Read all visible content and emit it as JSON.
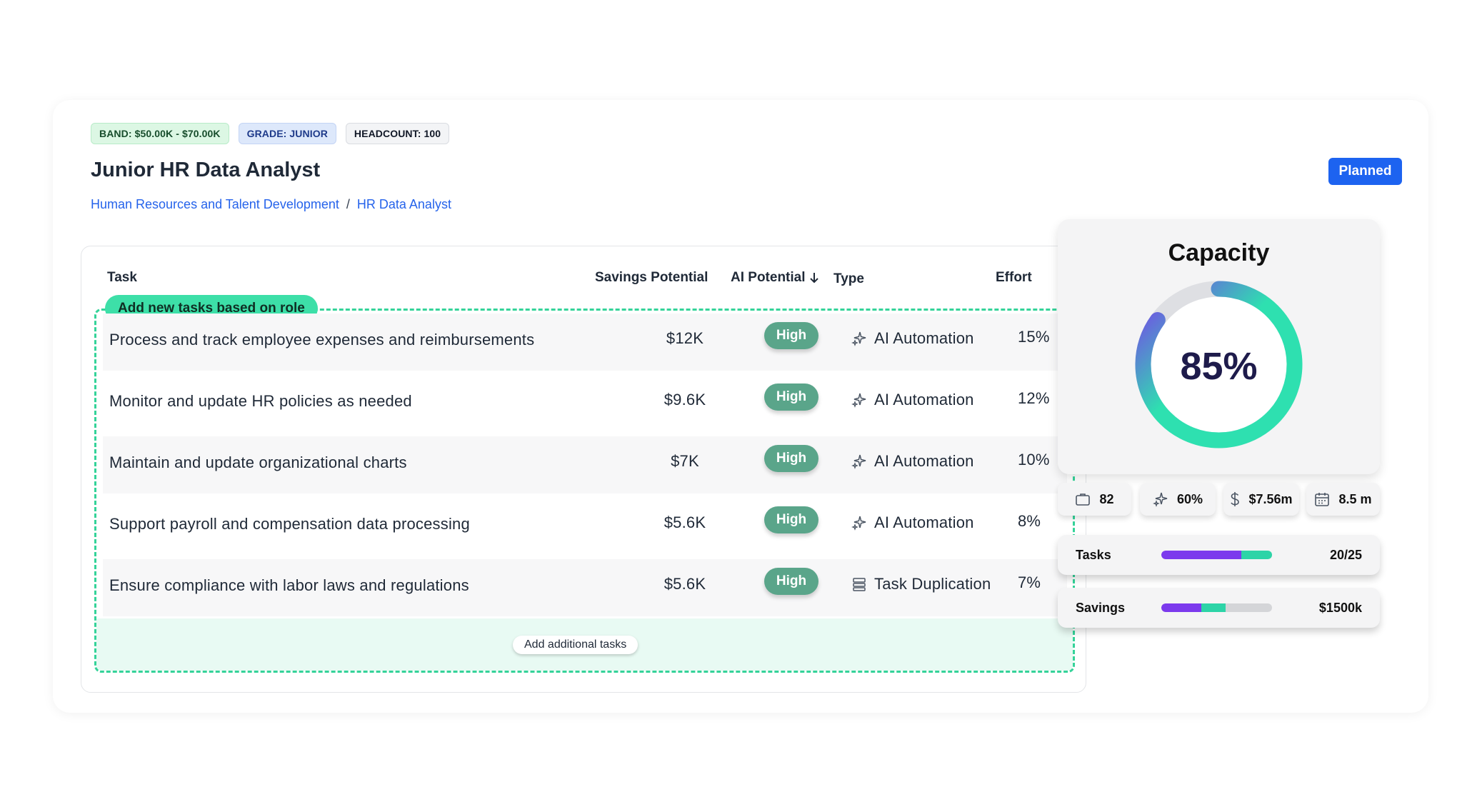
{
  "tags": {
    "band": "BAND: $50.00K - $70.00K",
    "grade": "GRADE: JUNIOR",
    "headcount": "HEADCOUNT: 100"
  },
  "role_title": "Junior HR Data Analyst",
  "breadcrumb": {
    "department": "Human Resources and Talent Development",
    "separator": "/",
    "role": "HR Data Analyst"
  },
  "status": "Planned",
  "table": {
    "headers": {
      "task": "Task",
      "savings": "Savings Potential",
      "ai": "AI Potential",
      "type": "Type",
      "effort": "Effort"
    },
    "add_new_label": "Add new tasks based on role",
    "rows": [
      {
        "task": "Process and track employee expenses and reimbursements",
        "savings": "$12K",
        "ai": "High",
        "type": "AI Automation",
        "type_icon": "sparkles-icon",
        "effort": "15%"
      },
      {
        "task": "Monitor and update HR policies as needed",
        "savings": "$9.6K",
        "ai": "High",
        "type": "AI Automation",
        "type_icon": "sparkles-icon",
        "effort": "12%"
      },
      {
        "task": "Maintain and update organizational charts",
        "savings": "$7K",
        "ai": "High",
        "type": "AI Automation",
        "type_icon": "sparkles-icon",
        "effort": "10%"
      },
      {
        "task": "Support payroll and compensation data processing",
        "savings": "$5.6K",
        "ai": "High",
        "type": "AI Automation",
        "type_icon": "sparkles-icon",
        "effort": "8%"
      },
      {
        "task": "Ensure compliance with labor laws and regulations",
        "savings": "$5.6K",
        "ai": "High",
        "type": "Task Duplication",
        "type_icon": "stack-icon",
        "effort": "7%"
      }
    ],
    "add_additional_label": "Add additional tasks"
  },
  "capacity": {
    "title": "Capacity",
    "value_label": "85%",
    "value": 0.85,
    "colors": {
      "start": "#2ee0b0",
      "end": "#7c3aed",
      "track": "#dedfe3"
    }
  },
  "stats": [
    {
      "icon": "briefcase-icon",
      "value": "82"
    },
    {
      "icon": "sparkles-icon",
      "value": "60%"
    },
    {
      "icon": "dollar-icon",
      "value": "$7.56m"
    },
    {
      "icon": "calendar-icon",
      "value": "8.5 m"
    }
  ],
  "bars": {
    "tasks": {
      "label": "Tasks",
      "value": "20/25",
      "purple_fraction": 0.72,
      "green_fraction": 0.28
    },
    "savings": {
      "label": "Savings",
      "value": "$1500k",
      "purple_fraction": 0.36,
      "green_fraction": 0.22
    }
  }
}
